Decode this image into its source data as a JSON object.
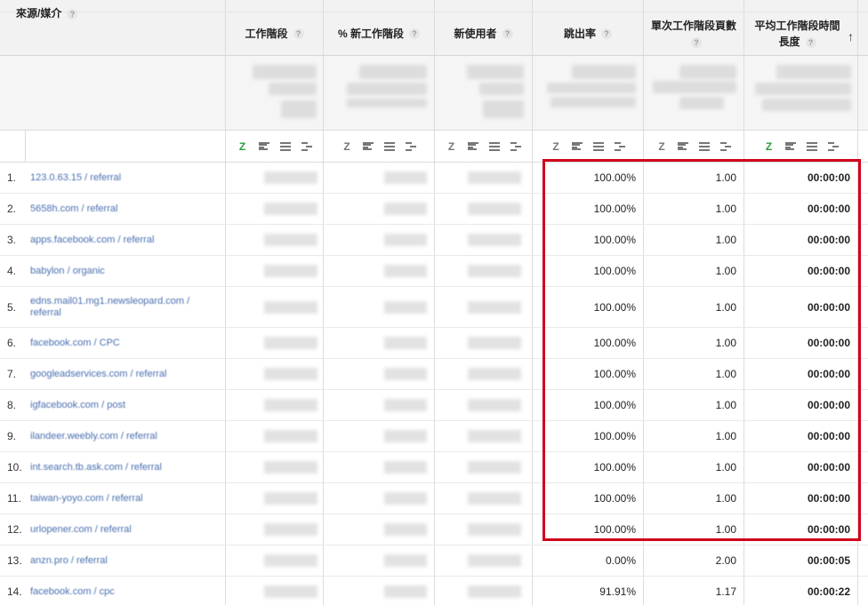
{
  "header": {
    "dimension": "來源/媒介",
    "columns": [
      {
        "label": "工作階段"
      },
      {
        "label": "% 新工作階段"
      },
      {
        "label": "新使用者"
      },
      {
        "label": "跳出率"
      },
      {
        "label": "單次工作階段頁數"
      },
      {
        "label": "平均工作階段時間長度"
      }
    ],
    "help_glyph": "?",
    "sort_indicator": "↑"
  },
  "viz_controls": {
    "z_label": "Z",
    "active_column": "平均工作階段時間長度"
  },
  "rows": [
    {
      "index": "1.",
      "source": "123.0.63.15 / referral",
      "bounce": "100.00%",
      "pages": "1.00",
      "duration": "00:00:00"
    },
    {
      "index": "2.",
      "source": "5658h.com / referral",
      "bounce": "100.00%",
      "pages": "1.00",
      "duration": "00:00:00"
    },
    {
      "index": "3.",
      "source": "apps.facebook.com / referral",
      "bounce": "100.00%",
      "pages": "1.00",
      "duration": "00:00:00"
    },
    {
      "index": "4.",
      "source": "babylon / organic",
      "bounce": "100.00%",
      "pages": "1.00",
      "duration": "00:00:00"
    },
    {
      "index": "5.",
      "source": "edns.mail01.mg1.newsleopard.com / referral",
      "bounce": "100.00%",
      "pages": "1.00",
      "duration": "00:00:00"
    },
    {
      "index": "6.",
      "source": "facebook.com / CPC",
      "bounce": "100.00%",
      "pages": "1.00",
      "duration": "00:00:00"
    },
    {
      "index": "7.",
      "source": "googleadservices.com / referral",
      "bounce": "100.00%",
      "pages": "1.00",
      "duration": "00:00:00"
    },
    {
      "index": "8.",
      "source": "igfacebook.com / post",
      "bounce": "100.00%",
      "pages": "1.00",
      "duration": "00:00:00"
    },
    {
      "index": "9.",
      "source": "ilandeer.weebly.com / referral",
      "bounce": "100.00%",
      "pages": "1.00",
      "duration": "00:00:00"
    },
    {
      "index": "10.",
      "source": "int.search.tb.ask.com / referral",
      "bounce": "100.00%",
      "pages": "1.00",
      "duration": "00:00:00"
    },
    {
      "index": "11.",
      "source": "taiwan-yoyo.com / referral",
      "bounce": "100.00%",
      "pages": "1.00",
      "duration": "00:00:00"
    },
    {
      "index": "12.",
      "source": "urlopener.com / referral",
      "bounce": "100.00%",
      "pages": "1.00",
      "duration": "00:00:00"
    },
    {
      "index": "13.",
      "source": "anzn.pro / referral",
      "bounce": "0.00%",
      "pages": "2.00",
      "duration": "00:00:05"
    },
    {
      "index": "14.",
      "source": "facebook.com / cpc",
      "bounce": "91.91%",
      "pages": "1.17",
      "duration": "00:00:22"
    }
  ],
  "colors": {
    "highlight": "#d0021b",
    "link": "#4a6fb0",
    "active_viz": "#2a9d3b"
  }
}
